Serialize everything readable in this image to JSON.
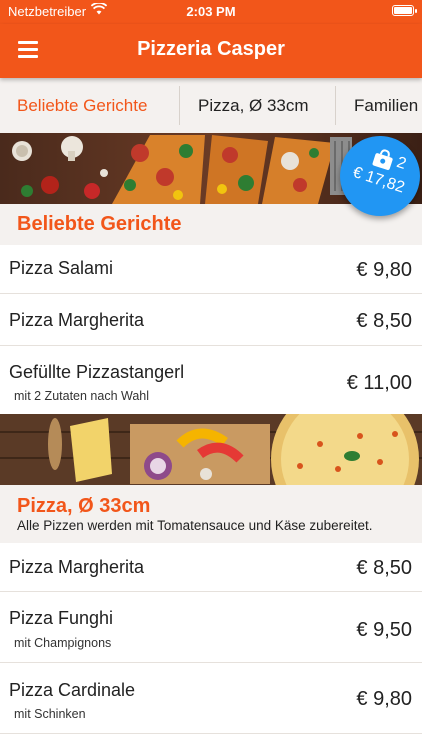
{
  "status_bar": {
    "carrier": "Netzbetreiber",
    "time": "2:03 PM"
  },
  "app_bar": {
    "title": "Pizzeria Casper"
  },
  "tabs": [
    {
      "label": "Beliebte Gerichte",
      "active": true
    },
    {
      "label": "Pizza, Ø 33cm",
      "active": false
    },
    {
      "label": "Familien",
      "active": false
    }
  ],
  "cart": {
    "count": "2",
    "total": "€ 17,82"
  },
  "sections": [
    {
      "title": "Beliebte Gerichte",
      "items": [
        {
          "name": "Pizza Salami",
          "price": "€ 9,80"
        },
        {
          "name": "Pizza Margherita",
          "price": "€ 8,50"
        },
        {
          "name": "Gefüllte Pizzastangerl",
          "sub": "mit 2 Zutaten nach Wahl",
          "price": "€ 11,00"
        }
      ]
    },
    {
      "title": "Pizza, Ø 33cm",
      "description": "Alle Pizzen werden mit Tomatensauce und Käse zubereitet.",
      "items": [
        {
          "name": "Pizza Margherita",
          "price": "€ 8,50"
        },
        {
          "name": "Pizza Funghi",
          "sub": "mit Champignons",
          "price": "€ 9,50"
        },
        {
          "name": "Pizza Cardinale",
          "sub": "mit Schinken",
          "price": "€ 9,80"
        }
      ]
    }
  ],
  "colors": {
    "brand": "#f2561a",
    "cart": "#2196f3",
    "section_bg": "#f4f1ef"
  }
}
